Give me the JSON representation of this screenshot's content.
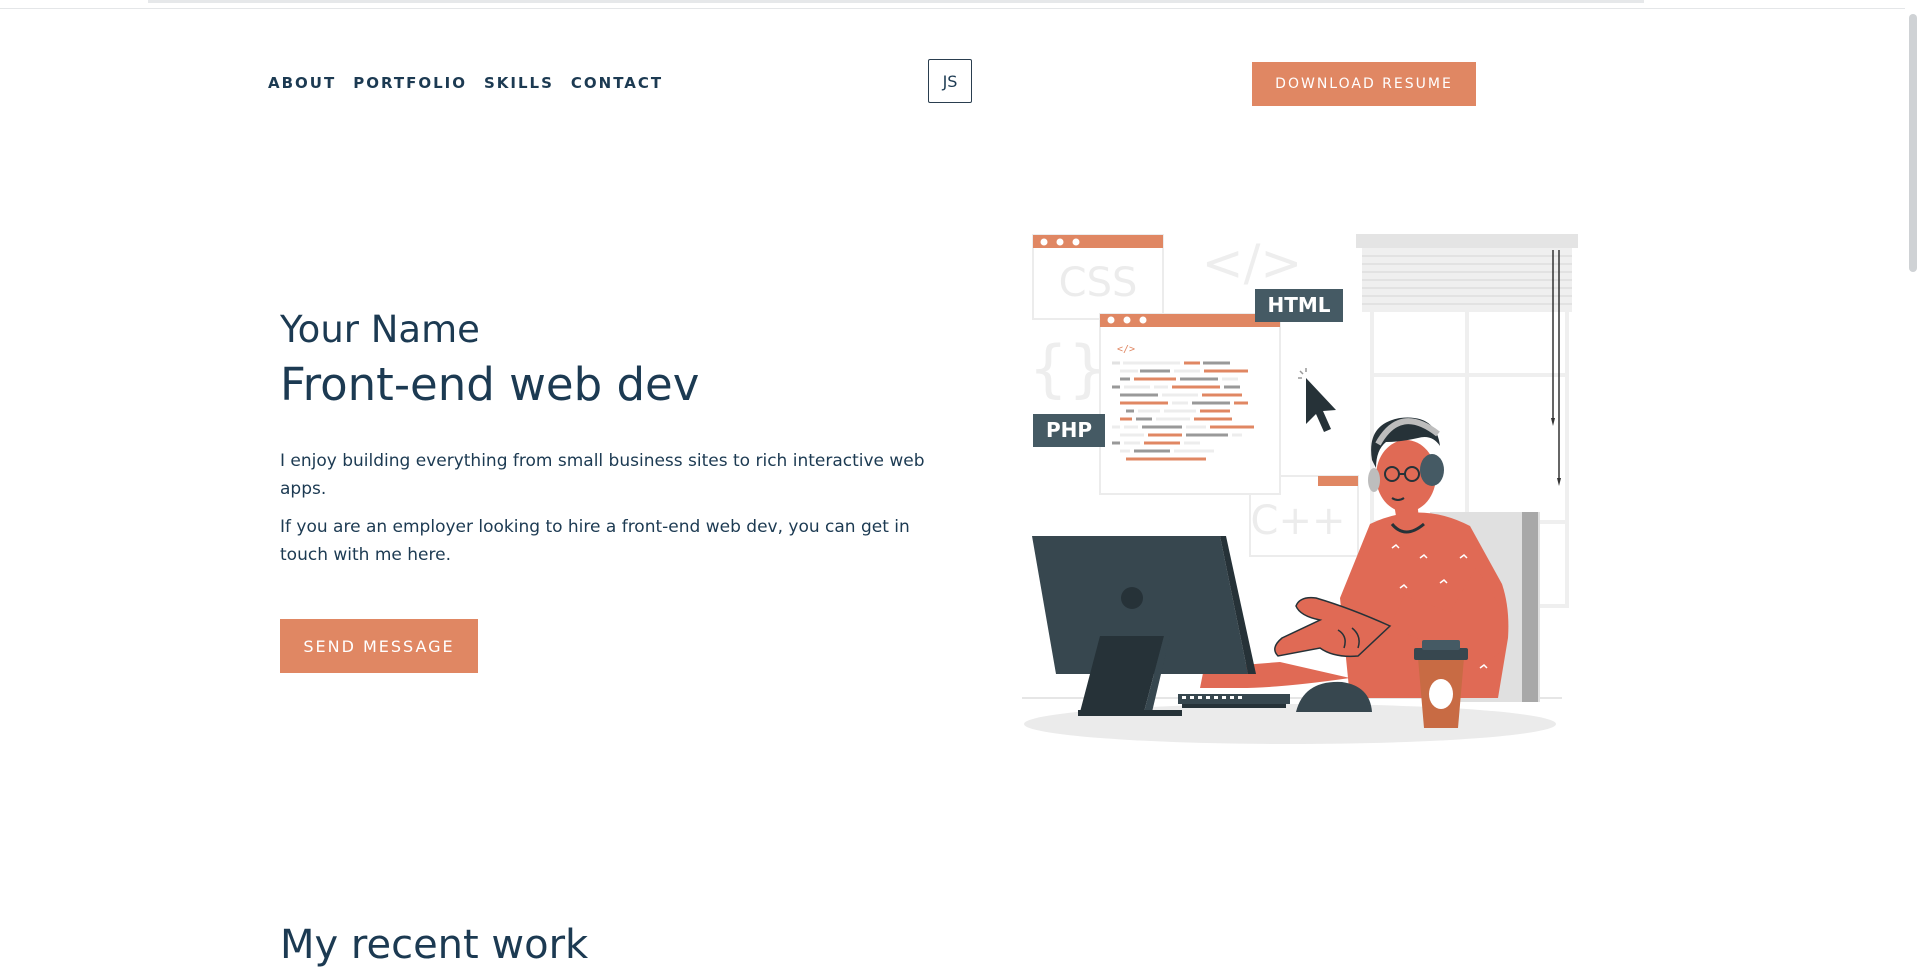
{
  "nav": {
    "items": [
      "ABOUT",
      "PORTFOLIO",
      "SKILLS",
      "CONTACT"
    ],
    "logo": "JS",
    "download_label": "DOWNLOAD RESUME"
  },
  "hero": {
    "name": "Your Name",
    "role": "Front-end web dev",
    "paragraph1": "I enjoy building everything from small business sites to rich interactive web apps.",
    "paragraph2": "If you are an employer looking to hire a front-end web dev, you can get in touch with me here.",
    "send_label": "SEND MESSAGE"
  },
  "illustration": {
    "tags": [
      "CSS",
      "HTML",
      "PHP",
      "C++"
    ],
    "code_brackets": "</>",
    "curly_braces": "{}",
    "small_code_tag": "</>"
  },
  "recent": {
    "title": "My recent work"
  },
  "colors": {
    "accent": "#e08763",
    "text": "#1c3a52",
    "dark_slate": "#37474f",
    "skin": "#e06a55"
  }
}
